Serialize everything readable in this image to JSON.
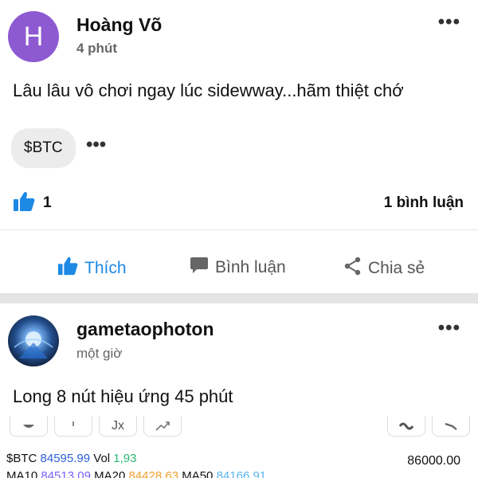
{
  "post1": {
    "avatar_letter": "H",
    "author": "Hoàng Võ",
    "time": "4 phút",
    "content": "Lâu lâu vô chơi ngay lúc sidewway...hãm thiệt chớ",
    "tag": "$BTC",
    "like_count": "1",
    "comment_count": "1 bình luận",
    "actions": {
      "like": "Thích",
      "comment": "Bình luận",
      "share": "Chia sẻ"
    }
  },
  "post2": {
    "author": "gametaophoton",
    "time": "một giờ",
    "content": "Long 8 nút hiệu ứng 45 phút",
    "chart": {
      "ticker": "$BTC",
      "price": "84595.99",
      "vol_label": "Vol",
      "vol": "1,93",
      "ma10_label": "MA10",
      "ma10": "84513.09",
      "ma20_label": "MA20",
      "ma20": "84428.63",
      "ma50_label": "MA50",
      "ma50": "84166.91",
      "price_tag": "86000.00",
      "toolbar_glyph_3": "Jx"
    }
  },
  "colors": {
    "accent": "#1e88e5",
    "avatar": "#8e5ad2",
    "ma10": "#7b61ff",
    "ma20": "#f0a030",
    "ma50": "#5ab4f0",
    "vol": "#2bb673"
  }
}
